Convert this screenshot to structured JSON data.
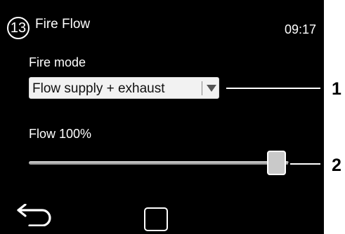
{
  "header": {
    "page_number": "13",
    "title": "Fire Flow",
    "time": "09:17"
  },
  "fire_mode": {
    "label": "Fire mode",
    "value": "Flow supply + exhaust"
  },
  "flow": {
    "label": "Flow 100%",
    "percent": 100
  },
  "nav": {
    "back_icon": "back-arrow-icon",
    "home_icon": "home-square-icon"
  },
  "callouts": [
    "1",
    "2"
  ],
  "colors": {
    "screen": "#000000",
    "text": "#ffffff",
    "dropdown": "#f2f2f2",
    "thumb": "#c9c9c9"
  }
}
